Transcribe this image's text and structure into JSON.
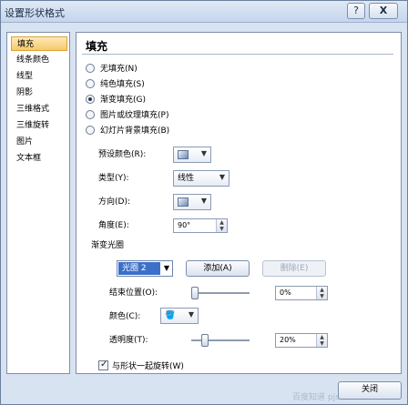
{
  "window": {
    "title": "设置形状格式",
    "help": "?",
    "close": "X"
  },
  "nav": {
    "items": [
      "填充",
      "线条颜色",
      "线型",
      "阴影",
      "三维格式",
      "三维旋转",
      "图片",
      "文本框"
    ],
    "selected": "填充"
  },
  "fill": {
    "heading": "填充",
    "options": [
      {
        "label": "无填充(N)",
        "selected": false
      },
      {
        "label": "纯色填充(S)",
        "selected": false
      },
      {
        "label": "渐变填充(G)",
        "selected": true
      },
      {
        "label": "图片或纹理填充(P)",
        "selected": false
      },
      {
        "label": "幻灯片背景填充(B)",
        "selected": false
      }
    ],
    "preset_color_label": "预设颜色(R):",
    "type_label": "类型(Y):",
    "type_value": "线性",
    "direction_label": "方向(D):",
    "angle_label": "角度(E):",
    "angle_value": "90°",
    "stops_label": "渐变光圈",
    "stop_selected": "光圈 2",
    "add_button": "添加(A)",
    "delete_button": "删除(E)",
    "end_position_label": "结束位置(O):",
    "end_position_value": "0%",
    "end_position_level": 0,
    "color_label": "颜色(C):",
    "transparency_label": "透明度(T):",
    "transparency_value": "20%",
    "transparency_level": 0.2,
    "rotate_with_shape_label": "与形状一起旋转(W)",
    "rotate_with_shape_checked": true
  },
  "footer": {
    "close_button": "关闭",
    "watermark": "百度知道 pjs.com"
  },
  "icons": {
    "preset-color": "gradient-swatch-icon",
    "direction": "gradient-swatch-icon",
    "color": "paint-bucket-icon"
  }
}
